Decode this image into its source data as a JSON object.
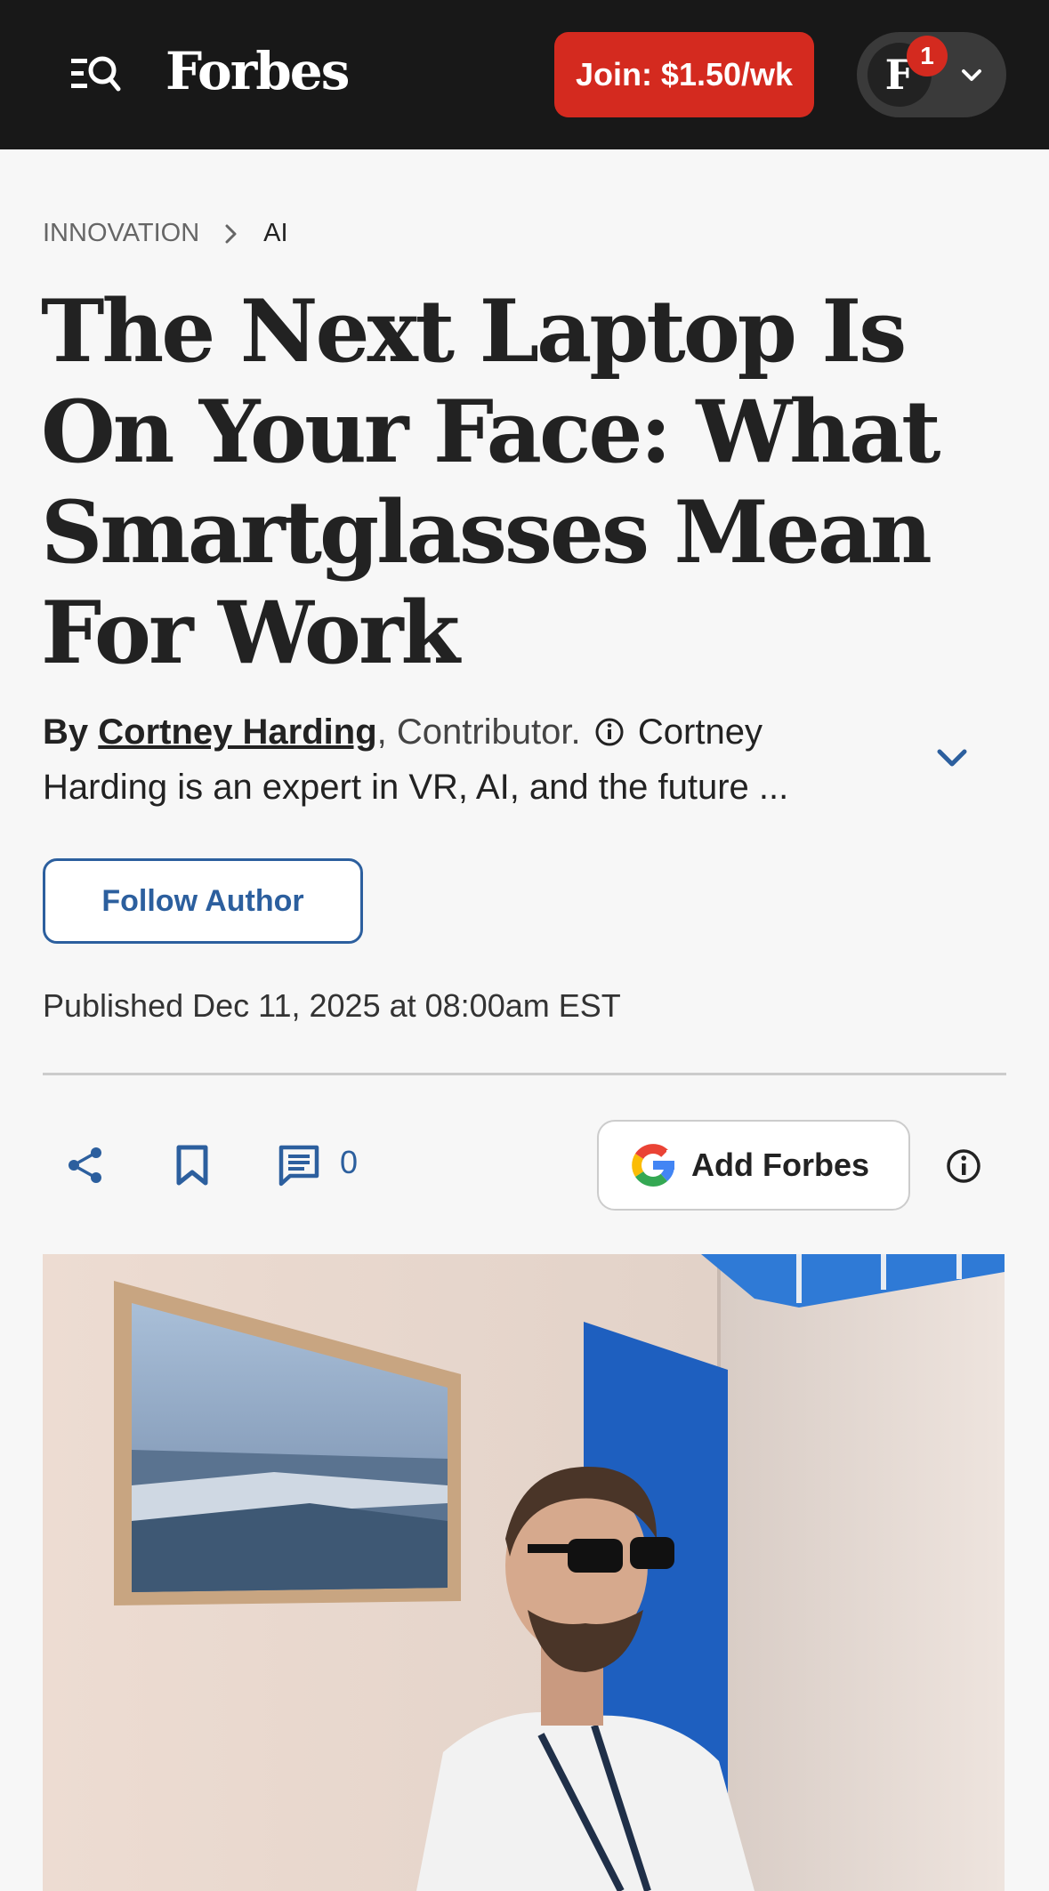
{
  "header": {
    "logo": "Forbes",
    "join_label": "Join: $1.50/wk",
    "avatar_letter": "F",
    "notification_count": "1"
  },
  "breadcrumb": {
    "section": "INNOVATION",
    "subsection": "AI"
  },
  "article": {
    "title": "The Next Laptop Is On Your Face: What Smartglasses Mean For Work",
    "by_label": "By",
    "author": "Cortney Harding",
    "role": ", Contributor.",
    "bio": "Cortney Harding is an expert in VR, AI, and the future ...",
    "follow_label": "Follow Author",
    "published": "Published Dec 11, 2025 at 08:00am EST"
  },
  "actions": {
    "comment_count": "0",
    "add_forbes_label": "Add Forbes"
  },
  "colors": {
    "accent_blue": "#2c5f9e",
    "brand_red": "#d42a1f",
    "header_bg": "#181818"
  }
}
